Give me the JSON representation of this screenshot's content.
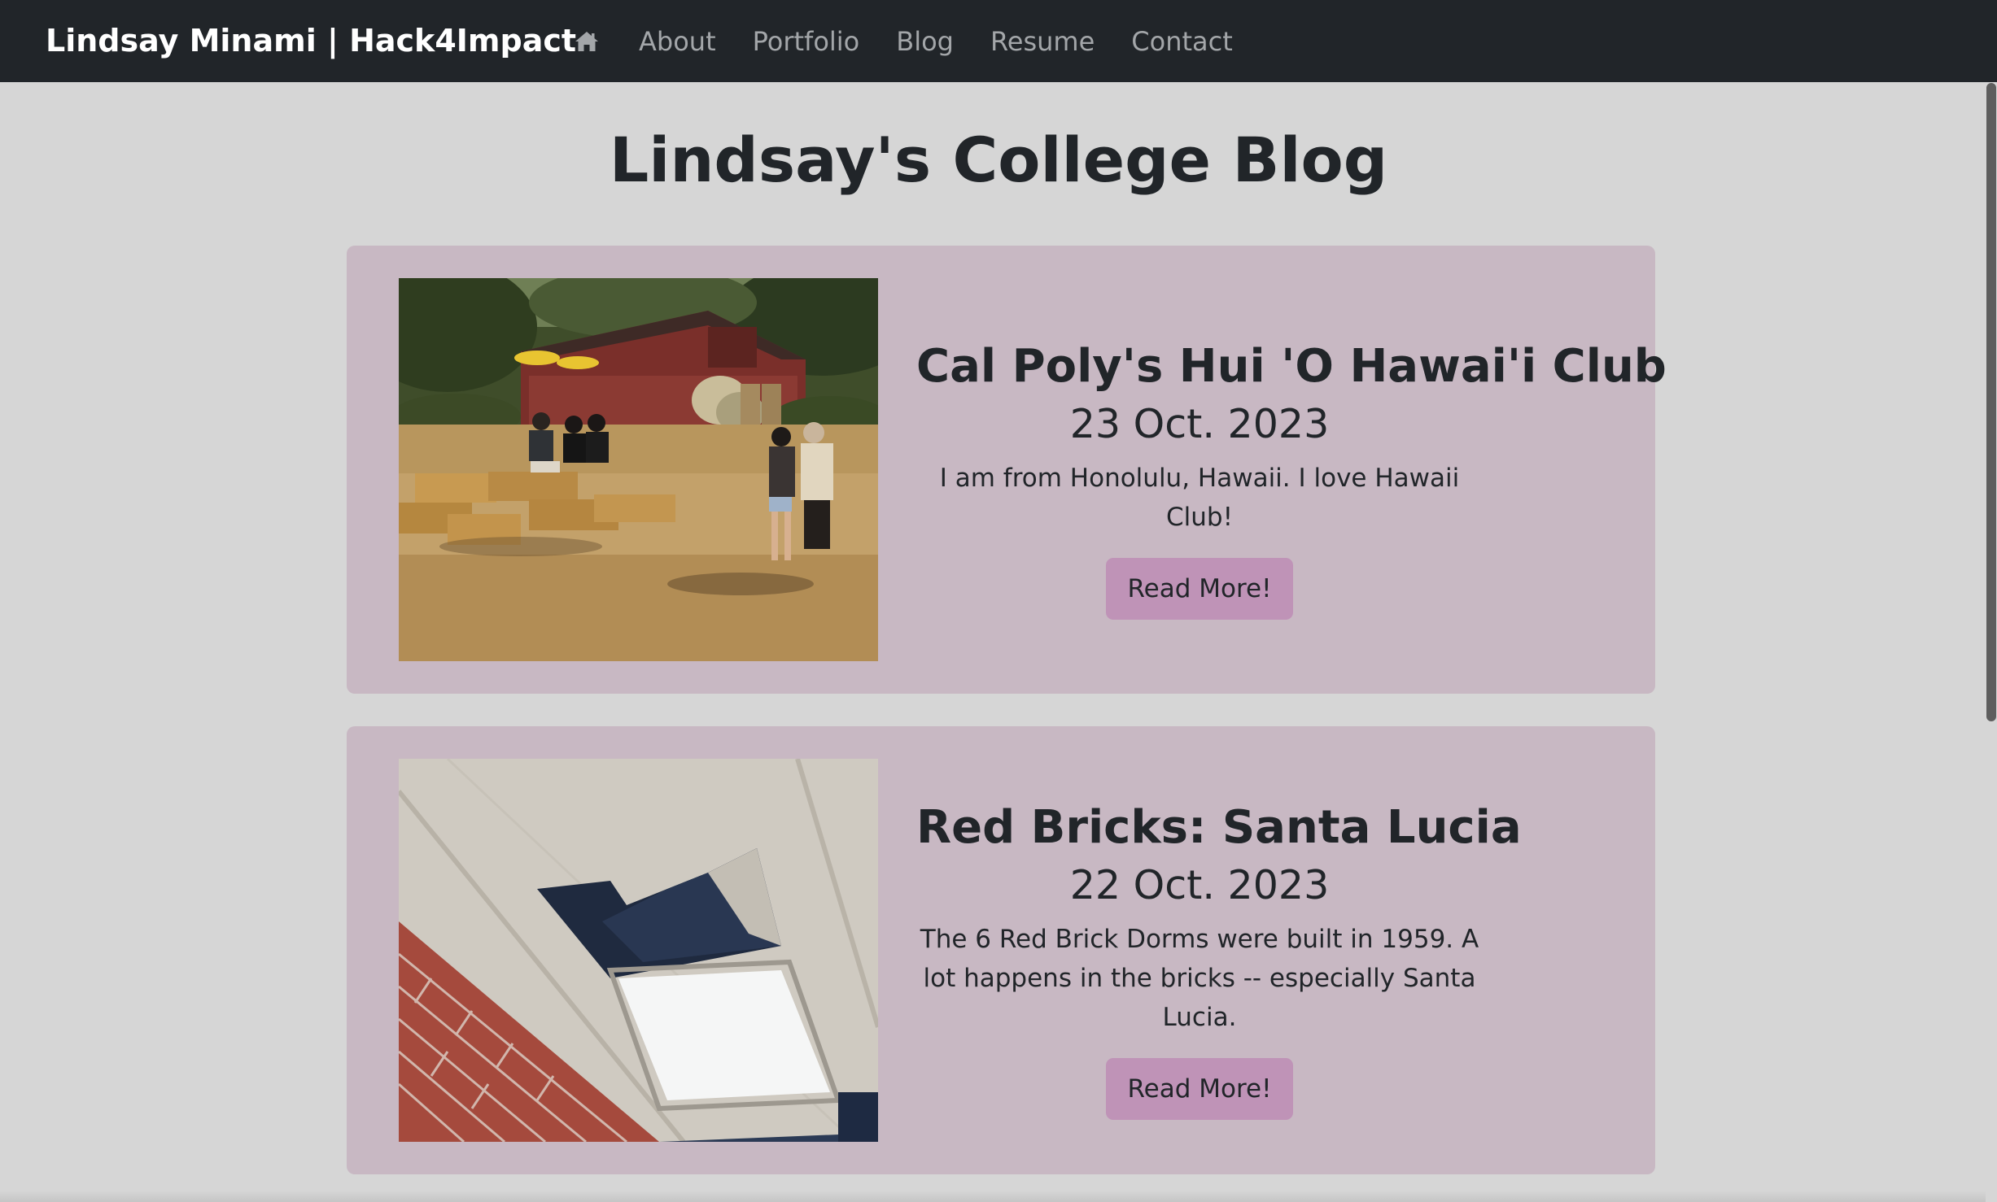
{
  "navbar": {
    "brand": "Lindsay Minami | Hack4Impact",
    "home_icon": "home-icon",
    "links": [
      "About",
      "Portfolio",
      "Blog",
      "Resume",
      "Contact"
    ]
  },
  "page": {
    "title": "Lindsay's College Blog"
  },
  "posts": [
    {
      "title": "Cal Poly's Hui 'O Hawai'i Club",
      "date": "23 Oct. 2023",
      "excerpt": "I am from Honolulu, Hawaii. I love Hawaii Club!",
      "button": "Read More!",
      "image": "photo-farm-hay-bales"
    },
    {
      "title": "Red Bricks: Santa Lucia",
      "date": "22 Oct. 2023",
      "excerpt": "The 6 Red Brick Dorms were built in 1959. A lot happens in the bricks -- especially Santa Lucia.",
      "button": "Read More!",
      "image": "photo-broken-ceiling"
    }
  ],
  "colors": {
    "navbar_bg": "#212529",
    "page_bg": "#d6d6d6",
    "card_bg": "#c8b8c3",
    "button_bg": "#bf93b7",
    "nav_link": "#a3a6a9"
  }
}
